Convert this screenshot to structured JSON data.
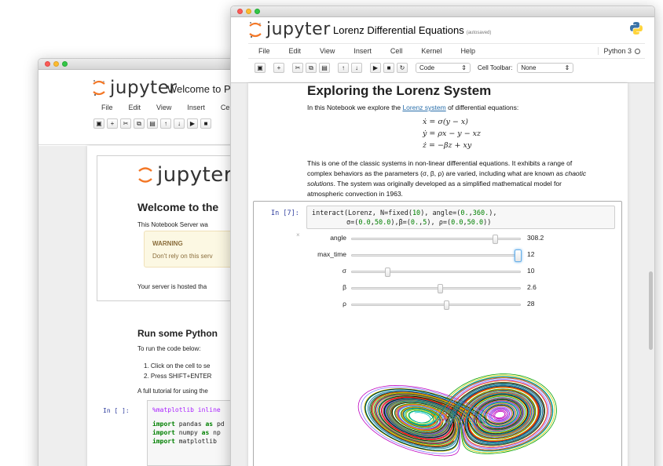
{
  "back_window": {
    "title": "Welcome to P",
    "logo_text": "jupyter",
    "menu": [
      "File",
      "Edit",
      "View",
      "Insert",
      "Cell"
    ],
    "toolbar_icons": [
      "save-icon",
      "plus-icon",
      "scissors-icon",
      "copy-icon",
      "paste-icon",
      "arrow-up-icon",
      "arrow-down-icon",
      "run-icon",
      "stop-icon"
    ],
    "content": {
      "logo_text": "jupyter",
      "heading": "Welcome to the",
      "intro": "This Notebook Server wa",
      "warning_title": "WARNING",
      "warning_text": "Don't rely on this serv",
      "hosted": "Your server is hosted tha",
      "run_heading": "Run some Python",
      "run_intro": "To run the code below:",
      "step1": "1.  Click on the cell to se",
      "step2": "2.  Press SHIFT+ENTER",
      "tutorial": "A full tutorial for using the",
      "prompt": "In [ ]:",
      "code_magic": "%matplotlib inline",
      "code_kw": "import",
      "code_line2": "pandas",
      "code_as": "as",
      "code_alias2": "pd",
      "code_line3": "numpy",
      "code_alias3": "np",
      "code_line4": "matplotlib"
    }
  },
  "front_window": {
    "logo_text": "jupyter",
    "notebook_title": "Lorenz Differential Equations",
    "autosave_status": "(autosaved)",
    "menu": [
      "File",
      "Edit",
      "View",
      "Insert",
      "Cell",
      "Kernel",
      "Help"
    ],
    "kernel_name": "Python 3",
    "toolbar_icons": [
      "save-icon",
      "plus-icon",
      "scissors-icon",
      "copy-icon",
      "paste-icon",
      "arrow-up-icon",
      "arrow-down-icon",
      "run-icon",
      "stop-icon",
      "restart-icon"
    ],
    "cell_type_select": "Code",
    "cell_toolbar_label": "Cell Toolbar:",
    "cell_toolbar_select": "None",
    "markdown": {
      "heading": "Exploring the Lorenz System",
      "intro_before": "In this Notebook we explore the ",
      "intro_link": "Lorenz system",
      "intro_after": " of differential equations:",
      "eq1": "ẋ = σ(y − x)",
      "eq2": "ẏ = ρx − y − xz",
      "eq3": "ż = −βz + xy",
      "para_line1": "This is one of the classic systems in non-linear differential equations. It exhibits a range of",
      "para_line2_before": "complex behaviors as the parameters (σ, β, ρ) are varied, including what are known as ",
      "para_line2_em": "chaotic",
      "para_line3_em": "solutions",
      "para_line3_after": ". The system was originally developed as a simplified mathematical model for",
      "para_line4": "atmospheric convection in 1963."
    },
    "code_cell": {
      "prompt": "In [7]:",
      "line1_a": "interact(Lorenz, N=fixed(",
      "line1_n1": "10",
      "line1_b": "), angle=(",
      "line1_n2": "0.",
      "line1_c": ",",
      "line1_n3": "360.",
      "line1_d": "),",
      "line2_a": "σ=(",
      "line2_n1": "0.0",
      "line2_b": ",",
      "line2_n2": "50.0",
      "line2_c": "),β=(",
      "line2_n3": "0.",
      "line2_d": ",",
      "line2_n4": "5",
      "line2_e": "), ρ=(",
      "line2_n5": "0.0",
      "line2_f": ",",
      "line2_n6": "50.0",
      "line2_g": "))"
    },
    "close_glyph": "×",
    "sliders": [
      {
        "label": "angle",
        "value": "308.2",
        "fraction": 0.856
      },
      {
        "label": "max_time",
        "value": "12",
        "fraction": 1.0
      },
      {
        "label": "σ",
        "value": "10",
        "fraction": 0.2
      },
      {
        "label": "β",
        "value": "2.6",
        "fraction": 0.52
      },
      {
        "label": "ρ",
        "value": "28",
        "fraction": 0.56
      }
    ]
  }
}
